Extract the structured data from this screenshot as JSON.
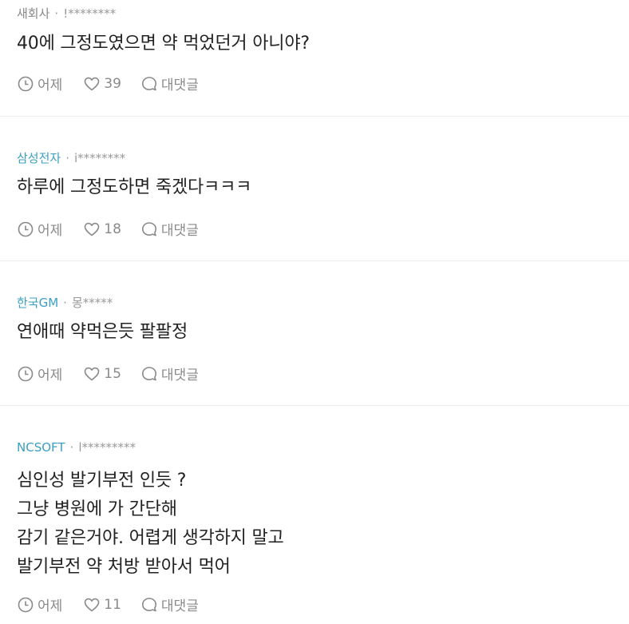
{
  "comments": [
    {
      "company": "새회사",
      "nickname": "!********",
      "lines": [
        "40에 그정도였으면 약 먹었던거 아니야?"
      ],
      "time": "어제",
      "likes": "39",
      "reply_label": "대댓글"
    },
    {
      "company": "삼성전자",
      "nickname": "i********",
      "lines": [
        "하루에 그정도하면 죽겠다ㅋㅋㅋ"
      ],
      "time": "어제",
      "likes": "18",
      "reply_label": "대댓글"
    },
    {
      "company": "한국GM",
      "nickname": "몽*****",
      "lines": [
        "연애때 약먹은듯 팔팔정"
      ],
      "time": "어제",
      "likes": "15",
      "reply_label": "대댓글"
    },
    {
      "company": "NCSOFT",
      "nickname": "l*********",
      "lines": [
        "심인성 발기부전 인듯 ?",
        "그냥 병원에 가 간단해",
        "감기 같은거야. 어렵게 생각하지 말고",
        "발기부전 약 처방 받아서 먹어"
      ],
      "time": "어제",
      "likes": "11",
      "reply_label": "대댓글"
    }
  ],
  "colors": {
    "company_link": "#3b9fc3",
    "meta_gray": "#999999",
    "action_gray": "#8a8a8a",
    "divider": "#ececec"
  },
  "icons": [
    "clock-icon",
    "heart-icon",
    "speech-bubble-icon"
  ]
}
